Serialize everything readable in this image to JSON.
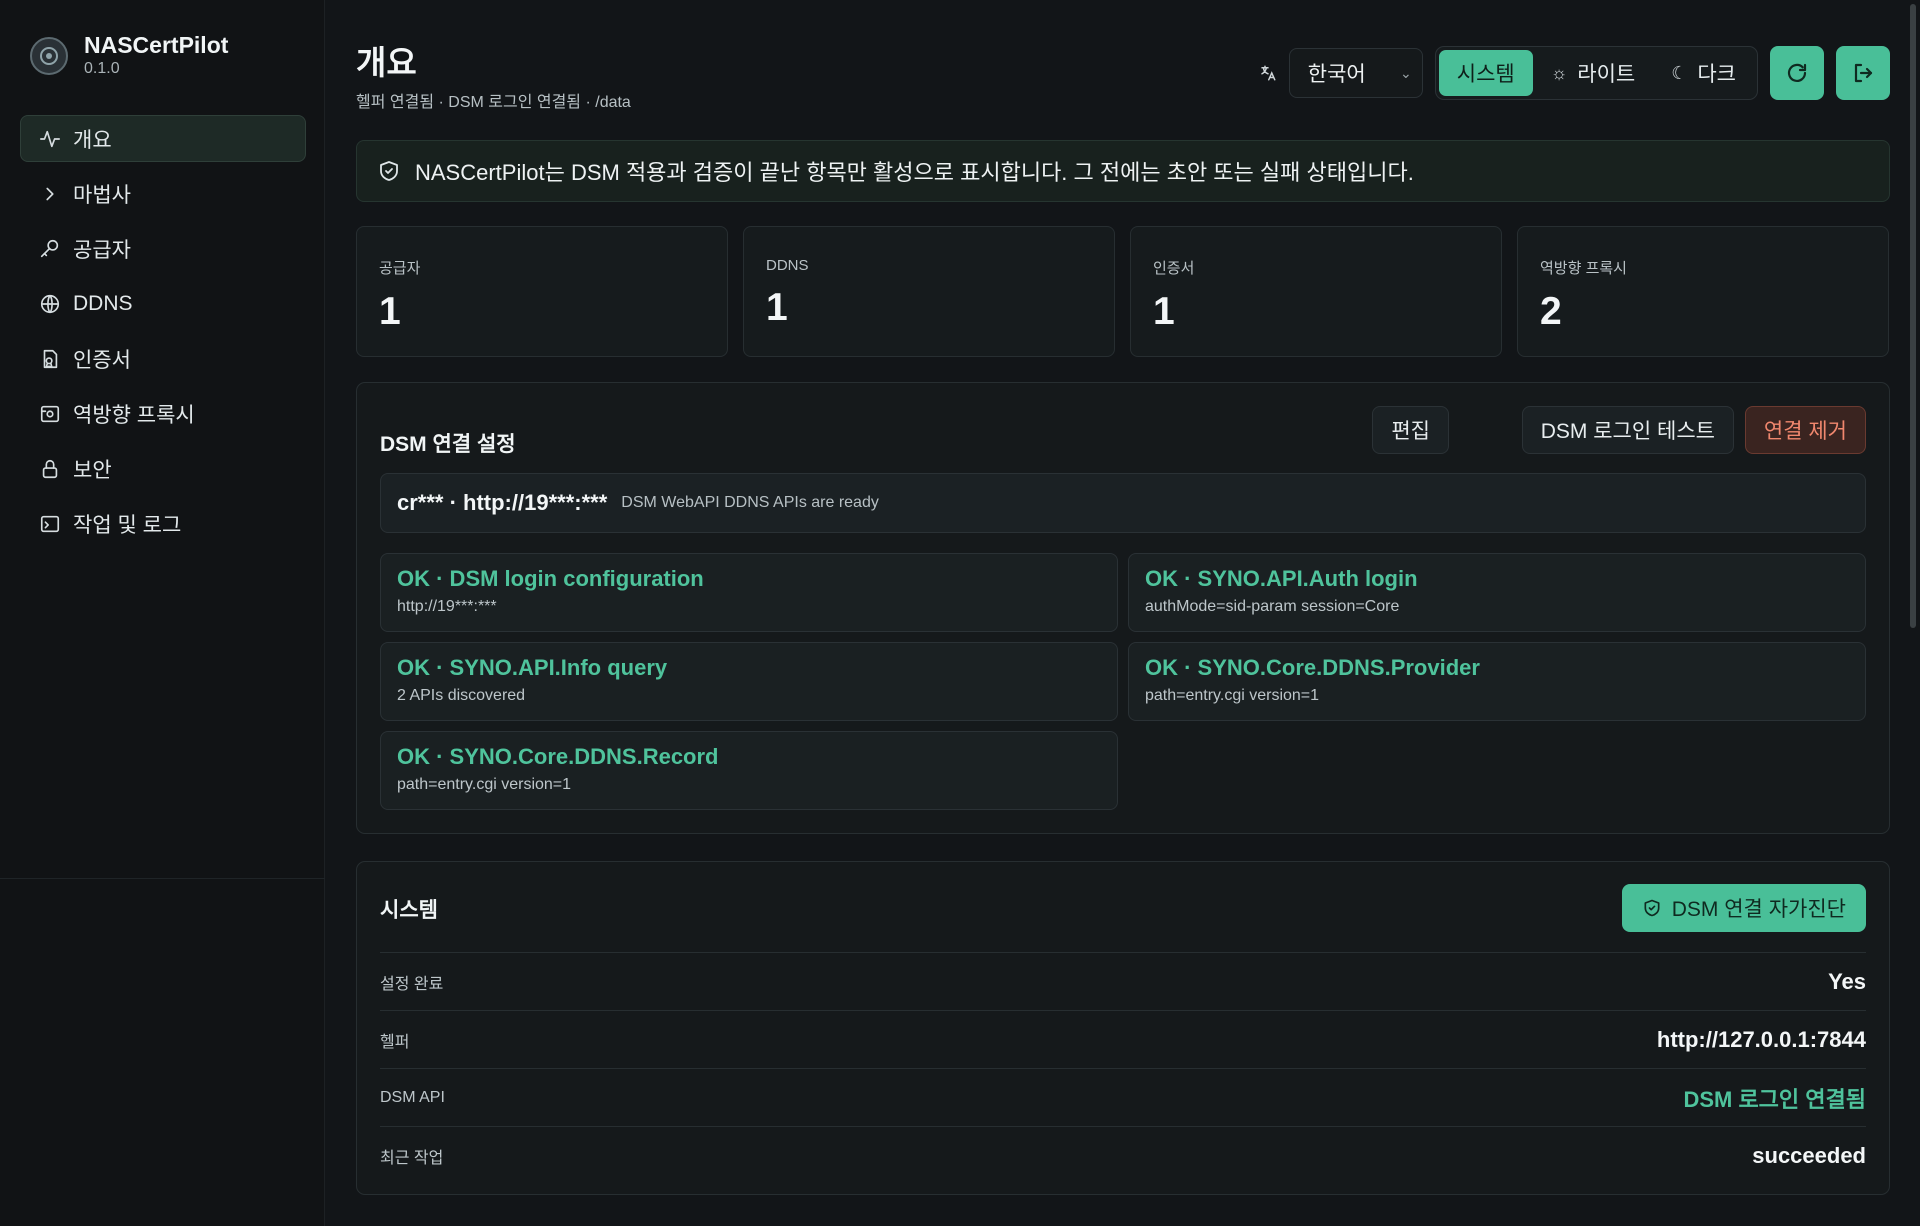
{
  "brand": {
    "name": "NASCertPilot",
    "version": "0.1.0"
  },
  "sidebar": {
    "items": [
      {
        "label": "개요",
        "icon": "activity-icon",
        "active": true
      },
      {
        "label": "마법사",
        "icon": "chevron-right-icon"
      },
      {
        "label": "공급자",
        "icon": "key-icon"
      },
      {
        "label": "DDNS",
        "icon": "globe-icon"
      },
      {
        "label": "인증서",
        "icon": "certificate-icon"
      },
      {
        "label": "역방향 프록시",
        "icon": "proxy-icon"
      },
      {
        "label": "보안",
        "icon": "lock-icon"
      },
      {
        "label": "작업 및 로그",
        "icon": "terminal-icon"
      }
    ]
  },
  "header": {
    "title": "개요",
    "subtitle": "헬퍼 연결됨 · DSM 로그인 연결됨 · /data"
  },
  "topbar": {
    "language": "한국어",
    "theme_system": "시스템",
    "theme_light": "라이트",
    "theme_dark": "다크"
  },
  "notice": "NASCertPilot는 DSM 적용과 검증이 끝난 항목만 활성으로 표시합니다. 그 전에는 초안 또는 실패 상태입니다.",
  "stats": [
    {
      "label": "공급자",
      "value": "1"
    },
    {
      "label": "DDNS",
      "value": "1"
    },
    {
      "label": "인증서",
      "value": "1"
    },
    {
      "label": "역방향 프록시",
      "value": "2"
    }
  ],
  "dsm": {
    "title": "DSM 연결 설정",
    "edit_label": "편집",
    "test_label": "DSM 로그인 테스트",
    "remove_label": "연결 제거",
    "connection": "cr*** · http://19***:***",
    "connection_note": "DSM WebAPI DDNS APIs are ready",
    "checks": [
      {
        "title": "OK · DSM login configuration",
        "detail": "http://19***:***"
      },
      {
        "title": "OK · SYNO.API.Auth login",
        "detail": "authMode=sid-param session=Core"
      },
      {
        "title": "OK · SYNO.API.Info query",
        "detail": "2 APIs discovered"
      },
      {
        "title": "OK · SYNO.Core.DDNS.Provider",
        "detail": "path=entry.cgi version=1"
      },
      {
        "title": "OK · SYNO.Core.DDNS.Record",
        "detail": "path=entry.cgi version=1"
      }
    ]
  },
  "system": {
    "title": "시스템",
    "diag_label": "DSM 연결 자가진단",
    "rows": [
      {
        "key": "설정 완료",
        "value": "Yes"
      },
      {
        "key": "헬퍼",
        "value": "http://127.0.0.1:7844"
      },
      {
        "key": "DSM API",
        "value": "DSM 로그인 연결됨"
      },
      {
        "key": "최근 작업",
        "value": "succeeded"
      }
    ]
  },
  "colors": {
    "accent": "#49bf98",
    "ok": "#4fc39c",
    "danger": "#f0876e",
    "background": "#121518"
  }
}
